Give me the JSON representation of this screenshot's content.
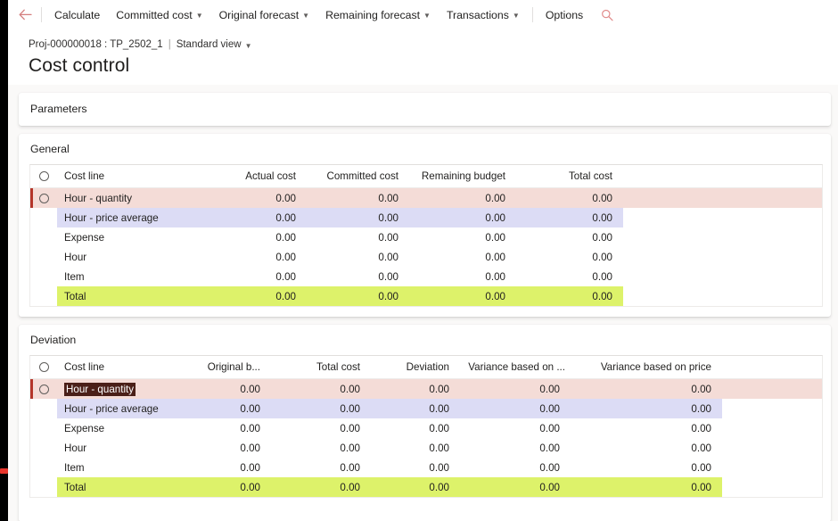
{
  "commandbar": {
    "back_icon": "back-arrow-icon",
    "search_icon": "search-icon",
    "items": [
      {
        "label": "Calculate",
        "has_caret": false
      },
      {
        "label": "Committed cost",
        "has_caret": true
      },
      {
        "label": "Original forecast",
        "has_caret": true
      },
      {
        "label": "Remaining forecast",
        "has_caret": true
      },
      {
        "label": "Transactions",
        "has_caret": true
      },
      {
        "label": "Options",
        "has_caret": false
      }
    ]
  },
  "header": {
    "breadcrumb_record": "Proj-000000018 : TP_2502_1",
    "breadcrumb_separator": "|",
    "breadcrumb_view": "Standard view",
    "breadcrumb_view_caret": "chevron-down-icon",
    "title": "Cost control"
  },
  "panels": {
    "parameters": {
      "title": "Parameters"
    },
    "general": {
      "title": "General"
    },
    "deviation": {
      "title": "Deviation"
    }
  },
  "general_grid": {
    "columns": [
      "Cost line",
      "Actual cost",
      "Committed cost",
      "Remaining budget",
      "Total cost"
    ],
    "rows": [
      {
        "name": "Hour - quantity",
        "values": [
          "0.00",
          "0.00",
          "0.00",
          "0.00"
        ],
        "state": "selected"
      },
      {
        "name": "Hour - price average",
        "values": [
          "0.00",
          "0.00",
          "0.00",
          "0.00"
        ],
        "state": "alt"
      },
      {
        "name": "Expense",
        "values": [
          "0.00",
          "0.00",
          "0.00",
          "0.00"
        ],
        "state": "normal"
      },
      {
        "name": "Hour",
        "values": [
          "0.00",
          "0.00",
          "0.00",
          "0.00"
        ],
        "state": "normal"
      },
      {
        "name": "Item",
        "values": [
          "0.00",
          "0.00",
          "0.00",
          "0.00"
        ],
        "state": "normal"
      },
      {
        "name": "Total",
        "values": [
          "0.00",
          "0.00",
          "0.00",
          "0.00"
        ],
        "state": "total"
      }
    ]
  },
  "deviation_grid": {
    "columns": [
      "Cost line",
      "Original b...",
      "Total cost",
      "Deviation",
      "Variance based on ...",
      "Variance based on price"
    ],
    "rows": [
      {
        "name": "Hour - quantity",
        "values": [
          "0.00",
          "0.00",
          "0.00",
          "0.00",
          "0.00"
        ],
        "state": "selected",
        "text_highlight": true
      },
      {
        "name": "Hour - price average",
        "values": [
          "0.00",
          "0.00",
          "0.00",
          "0.00",
          "0.00"
        ],
        "state": "alt"
      },
      {
        "name": "Expense",
        "values": [
          "0.00",
          "0.00",
          "0.00",
          "0.00",
          "0.00"
        ],
        "state": "normal"
      },
      {
        "name": "Hour",
        "values": [
          "0.00",
          "0.00",
          "0.00",
          "0.00",
          "0.00"
        ],
        "state": "normal"
      },
      {
        "name": "Item",
        "values": [
          "0.00",
          "0.00",
          "0.00",
          "0.00",
          "0.00"
        ],
        "state": "normal"
      },
      {
        "name": "Total",
        "values": [
          "0.00",
          "0.00",
          "0.00",
          "0.00",
          "0.00"
        ],
        "state": "total"
      }
    ]
  },
  "colors": {
    "selected_row": "#f4dcd7",
    "selected_marker": "#b4352a",
    "alt_row": "#dcdcf5",
    "total_row": "#ddf26a",
    "accent": "#d47f7f",
    "text_selection": "#4a1f18"
  }
}
